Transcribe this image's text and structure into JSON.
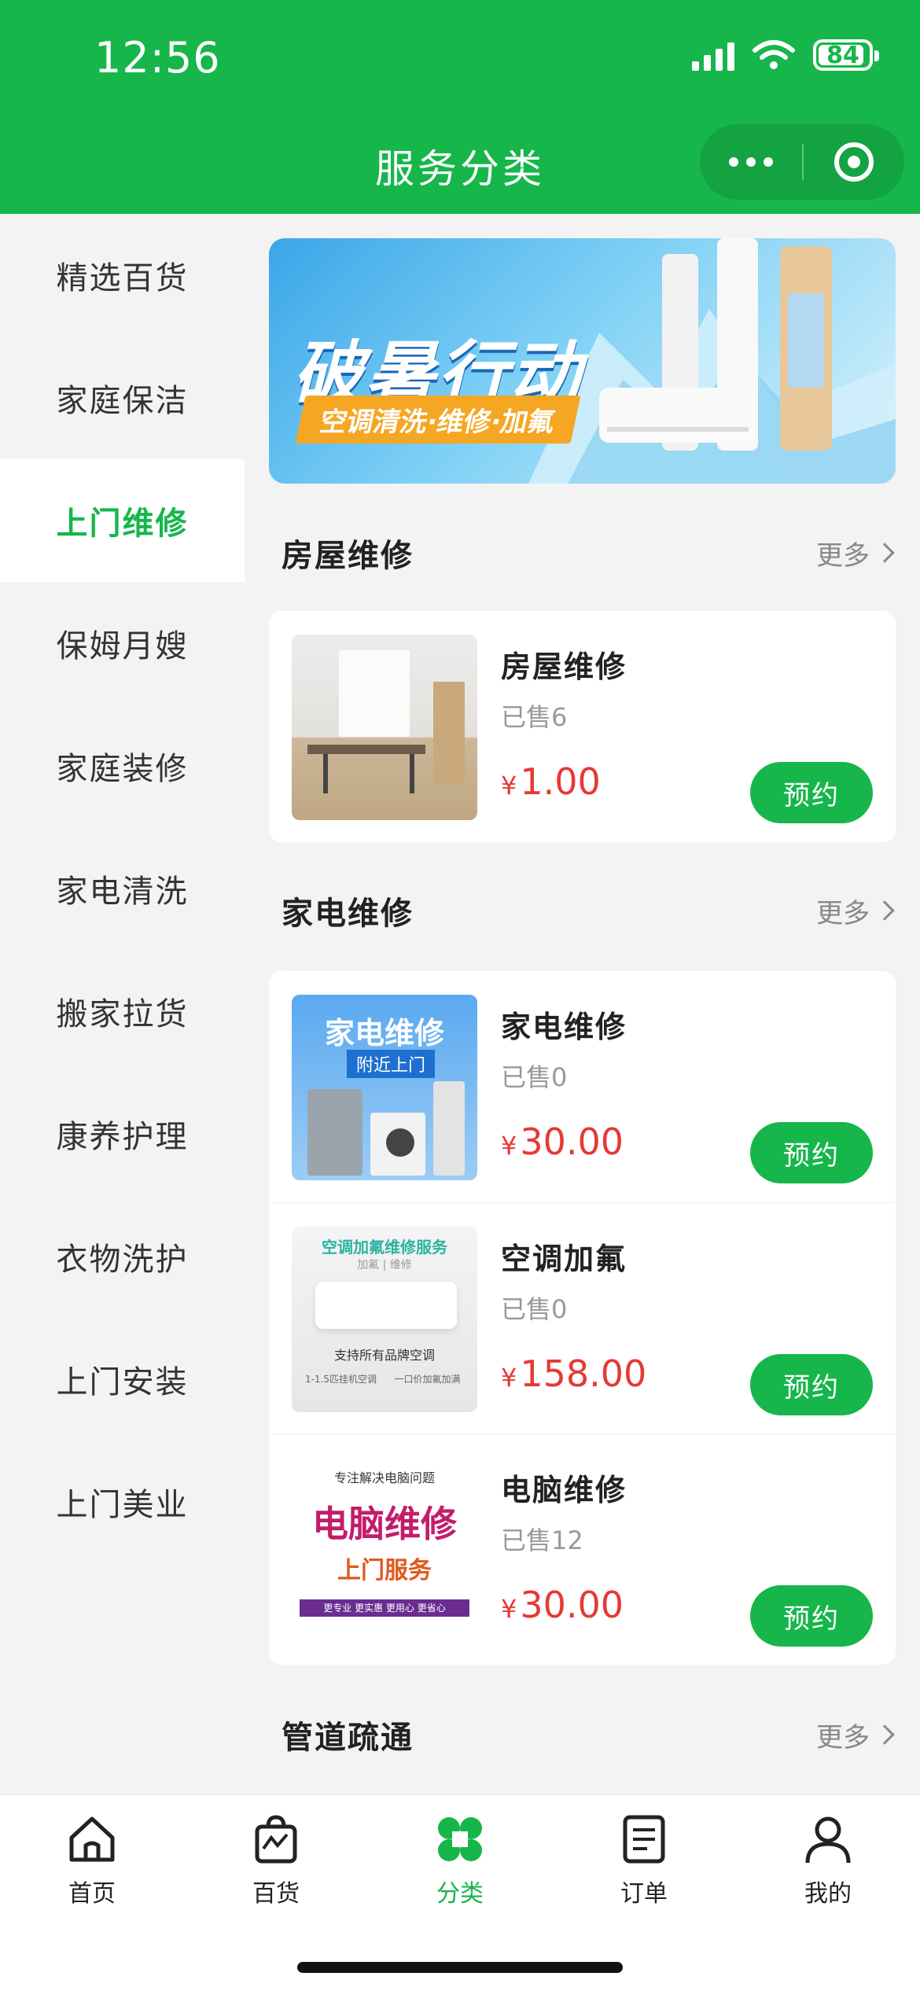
{
  "status_bar": {
    "time": "12:56",
    "battery": "84"
  },
  "header": {
    "title": "服务分类"
  },
  "sidebar": {
    "items": [
      {
        "label": "精选百货",
        "active": false
      },
      {
        "label": "家庭保洁",
        "active": false
      },
      {
        "label": "上门维修",
        "active": true
      },
      {
        "label": "保姆月嫂",
        "active": false
      },
      {
        "label": "家庭装修",
        "active": false
      },
      {
        "label": "家电清洗",
        "active": false
      },
      {
        "label": "搬家拉货",
        "active": false
      },
      {
        "label": "康养护理",
        "active": false
      },
      {
        "label": "衣物洗护",
        "active": false
      },
      {
        "label": "上门安装",
        "active": false
      },
      {
        "label": "上门美业",
        "active": false
      }
    ]
  },
  "banner": {
    "title": "破暑行动",
    "subtitle": "空调清洗·维修·加氟"
  },
  "sections": [
    {
      "title": "房屋维修",
      "more": "更多",
      "products": [
        {
          "name": "房屋维修",
          "sold": "已售6",
          "currency": "¥",
          "price": "1.00",
          "button": "预约",
          "thumb": "house"
        }
      ]
    },
    {
      "title": "家电维修",
      "more": "更多",
      "products": [
        {
          "name": "家电维修",
          "sold": "已售0",
          "currency": "¥",
          "price": "30.00",
          "button": "预约",
          "thumb": "appliance",
          "thumb_text": {
            "title": "家电维修",
            "sub": "附近上门"
          }
        },
        {
          "name": "空调加氟",
          "sold": "已售0",
          "currency": "¥",
          "price": "158.00",
          "button": "预约",
          "thumb": "ac",
          "thumb_text": {
            "title": "空调加氟维修服务",
            "sub": "加氟 | 维修",
            "line": "支持所有品牌空调",
            "note1": "1-1.5匹挂机空调",
            "note2": "一口价加氟加满"
          }
        },
        {
          "name": "电脑维修",
          "sold": "已售12",
          "currency": "¥",
          "price": "30.00",
          "button": "预约",
          "thumb": "pc",
          "thumb_text": {
            "top": "专注解决电脑问题",
            "title": "电脑维修",
            "sub": "上门服务",
            "tags": "更专业 更实惠 更用心 更省心"
          }
        }
      ]
    },
    {
      "title": "管道疏通",
      "more": "更多",
      "products": []
    }
  ],
  "tabbar": {
    "items": [
      {
        "label": "首页",
        "icon": "home-icon",
        "active": false
      },
      {
        "label": "百货",
        "icon": "shopping-bag-icon",
        "active": false
      },
      {
        "label": "分类",
        "icon": "category-icon",
        "active": true
      },
      {
        "label": "订单",
        "icon": "order-icon",
        "active": false
      },
      {
        "label": "我的",
        "icon": "profile-icon",
        "active": false
      }
    ]
  },
  "colors": {
    "brand": "#16b64b",
    "price": "#e53935"
  }
}
